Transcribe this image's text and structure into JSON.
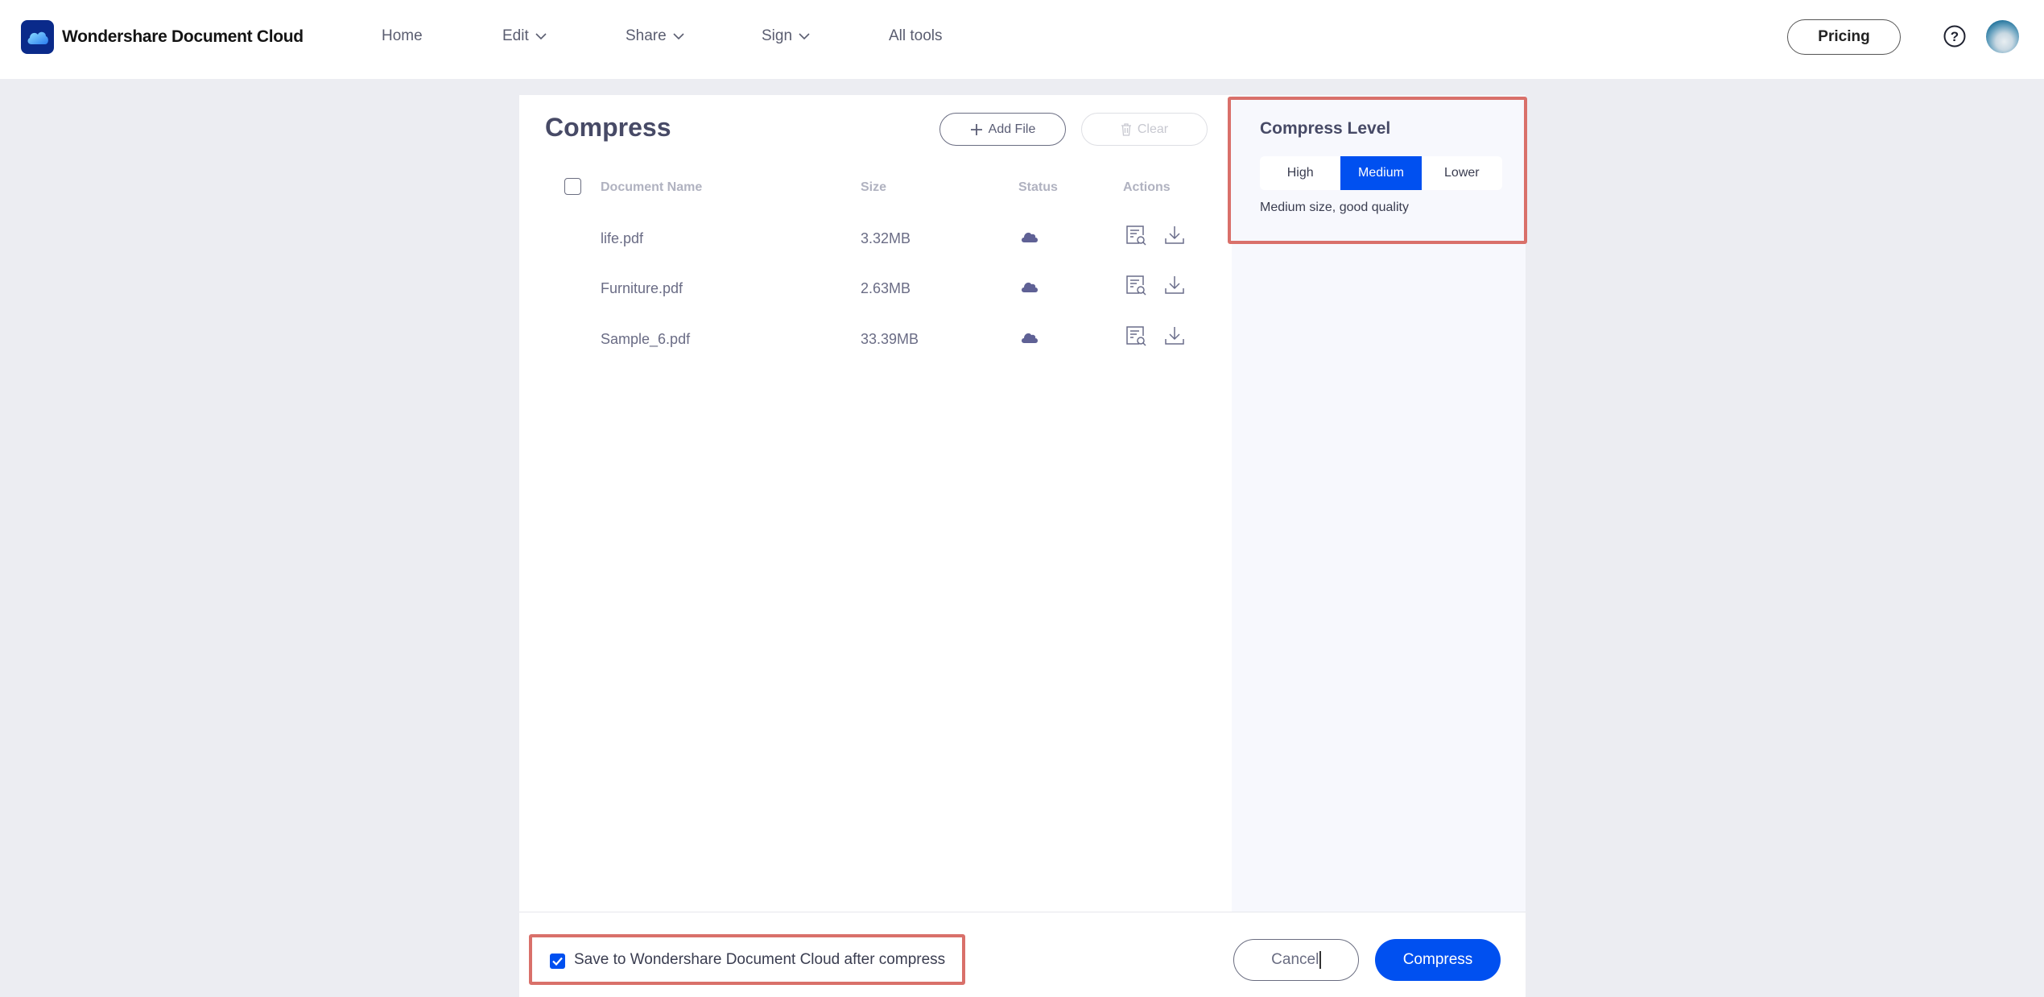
{
  "header": {
    "brand": "Wondershare Document Cloud",
    "nav": [
      {
        "label": "Home",
        "has_dropdown": false
      },
      {
        "label": "Edit",
        "has_dropdown": true
      },
      {
        "label": "Share",
        "has_dropdown": true
      },
      {
        "label": "Sign",
        "has_dropdown": true
      },
      {
        "label": "All tools",
        "has_dropdown": false
      }
    ],
    "pricing_label": "Pricing",
    "help_icon": "question-circle-icon",
    "avatar_icon": "user-avatar"
  },
  "main": {
    "title": "Compress",
    "add_file_label": "Add File",
    "clear_label": "Clear",
    "table": {
      "columns": [
        "Document Name",
        "Size",
        "Status",
        "Actions"
      ],
      "rows": [
        {
          "name": "life.pdf",
          "size": "3.32MB",
          "status_icon": "cloud-icon",
          "actions": [
            "preview-icon",
            "download-icon"
          ]
        },
        {
          "name": "Furniture.pdf",
          "size": "2.63MB",
          "status_icon": "cloud-icon",
          "actions": [
            "preview-icon",
            "download-icon"
          ]
        },
        {
          "name": "Sample_6.pdf",
          "size": "33.39MB",
          "status_icon": "cloud-icon",
          "actions": [
            "preview-icon",
            "download-icon"
          ]
        }
      ]
    }
  },
  "compress_level": {
    "title": "Compress Level",
    "options": [
      "High",
      "Medium",
      "Lower"
    ],
    "selected": "Medium",
    "description": "Medium size, good quality"
  },
  "footer": {
    "save_checkbox_checked": true,
    "save_label": "Save to Wondershare Document Cloud after compress",
    "cancel_label": "Cancel",
    "compress_label": "Compress"
  },
  "colors": {
    "accent": "#0050f0",
    "highlight_border": "#d9706a",
    "icon_color": "#5f6195"
  }
}
